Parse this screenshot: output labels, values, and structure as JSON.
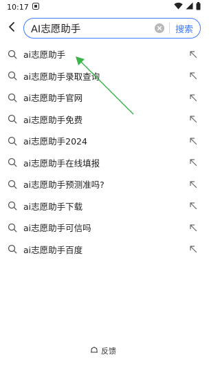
{
  "status_bar": {
    "time": "10:17",
    "notification_icon": "app-badge-icon",
    "wifi_icon": "wifi-icon",
    "signal_icon": "signal-icon",
    "battery_icon": "battery-icon"
  },
  "search": {
    "query": "AI志愿助手",
    "button_label": "搜索",
    "accent_color": "#3a7bff"
  },
  "suggestions": [
    "ai志愿助手",
    "ai志愿助手录取查询",
    "ai志愿助手官网",
    "ai志愿助手免费",
    "ai志愿助手2024",
    "ai志愿助手在线填报",
    "ai志愿助手预测准吗?",
    "ai志愿助手下载",
    "ai志愿助手可信吗",
    "ai志愿助手百度"
  ],
  "annotation": {
    "arrow_color": "#3bb54a"
  },
  "footer": {
    "feedback_label": "反馈"
  }
}
